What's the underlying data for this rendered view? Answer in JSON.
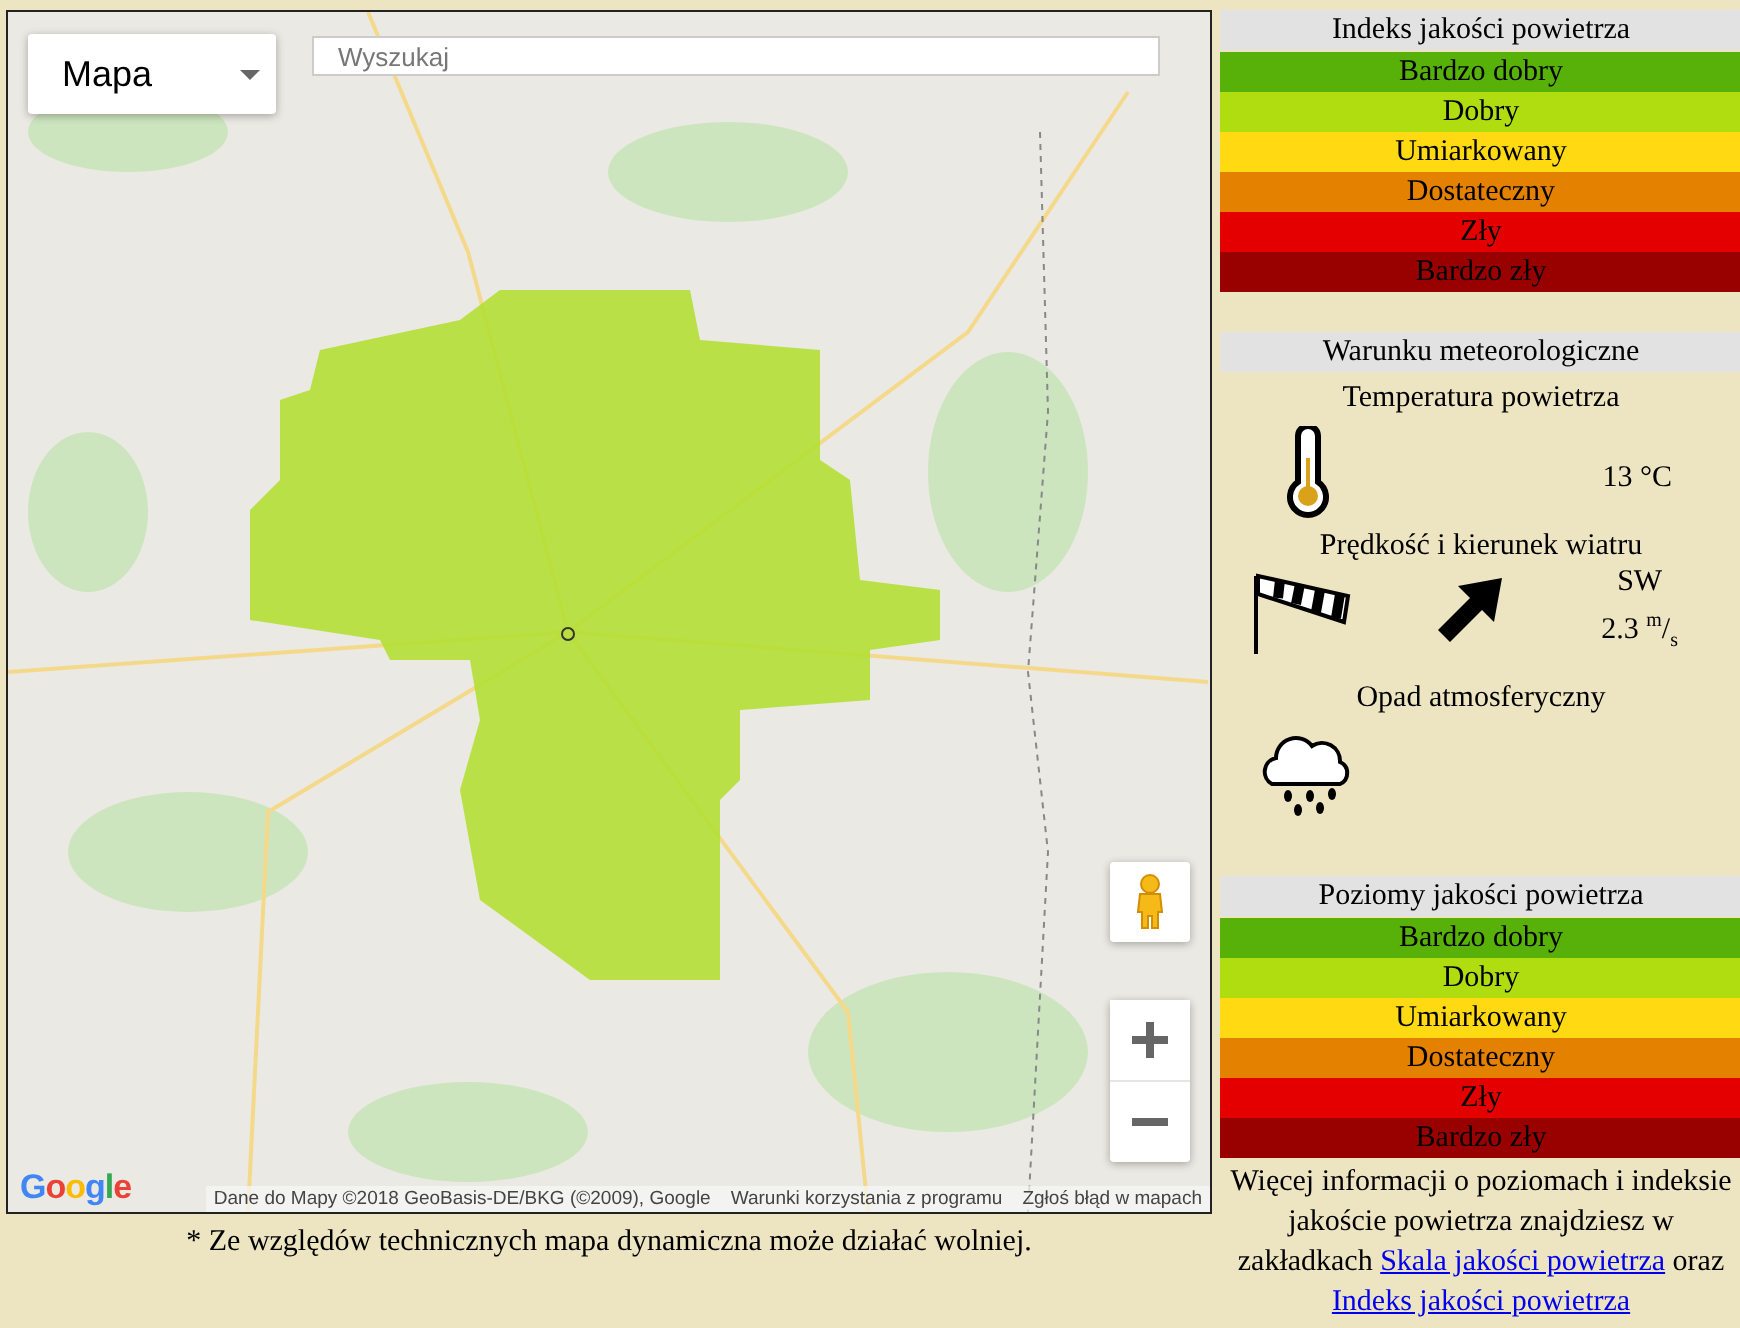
{
  "map": {
    "type_control": {
      "label": "Mapa"
    },
    "search": {
      "placeholder": "Wyszukaj"
    },
    "logo": "Google",
    "attribution": [
      "Dane do Mapy ©2018 GeoBasis-DE/BKG (©2009), Google",
      "Warunki korzystania z programu",
      "Zgłoś błąd w mapach"
    ]
  },
  "map_note": "* Ze względów technicznych mapa dynamiczna może działać wolniej.",
  "index_legend": {
    "title": "Indeks jakości powietrza",
    "levels": [
      {
        "label": "Bardzo dobry",
        "color": "#57b108"
      },
      {
        "label": "Dobry",
        "color": "#b0dd10"
      },
      {
        "label": "Umiarkowany",
        "color": "#ffd911"
      },
      {
        "label": "Dostateczny",
        "color": "#e58100"
      },
      {
        "label": "Zły",
        "color": "#e50000"
      },
      {
        "label": "Bardzo zły",
        "color": "#990000"
      }
    ]
  },
  "weather": {
    "title": "Warunku meteorologiczne",
    "temperature": {
      "label": "Temperatura powietrza",
      "value": "13 °C"
    },
    "wind": {
      "label": "Prędkość i kierunek wiatru",
      "direction": "SW",
      "speed": "2.3 $^{m}$/$_{s}$"
    },
    "precipitation": {
      "label": "Opad atmosferyczny"
    }
  },
  "levels_legend": {
    "title": "Poziomy jakości powietrza",
    "levels": [
      {
        "label": "Bardzo dobry",
        "color": "#57b108"
      },
      {
        "label": "Dobry",
        "color": "#b0dd10"
      },
      {
        "label": "Umiarkowany",
        "color": "#ffd911"
      },
      {
        "label": "Dostateczny",
        "color": "#e58100"
      },
      {
        "label": "Zły",
        "color": "#e50000"
      },
      {
        "label": "Bardzo zły",
        "color": "#990000"
      }
    ]
  },
  "info": {
    "text": "Więcej informacji o poziomach i indeksie jakoście powietrza znajdziesz w zakładkach",
    "link_1": "Skala jakości powietrza",
    "joiner": "oraz",
    "link_2": "Indeks jakości powietrza"
  }
}
